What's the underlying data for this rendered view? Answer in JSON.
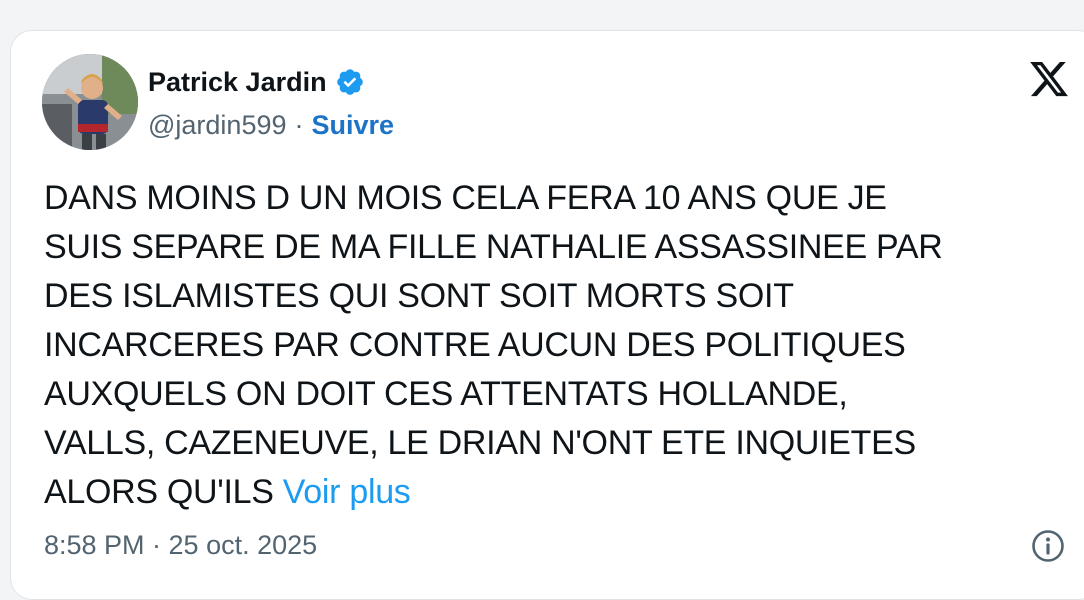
{
  "author": {
    "name": "Patrick Jardin",
    "handle": "@jardin599",
    "separator": "·",
    "follow_label": "Suivre",
    "verified": true,
    "verified_color": "#1d9bf0"
  },
  "tweet": {
    "lines": [
      "DANS MOINS D UN MOIS CELA FERA 10 ANS QUE JE",
      "SUIS SEPARE DE MA FILLE NATHALIE ASSASSINEE PAR",
      "DES ISLAMISTES QUI SONT SOIT MORTS SOIT",
      "INCARCERES PAR CONTRE AUCUN DES POLITIQUES",
      "AUXQUELS ON DOIT CES ATTENTATS HOLLANDE,",
      "VALLS, CAZENEUVE, LE DRIAN N'ONT ETE INQUIETES",
      "ALORS QU'ILS"
    ],
    "more_label": "Voir plus",
    "timestamp": "8:58 PM · 25 oct. 2025"
  },
  "icons": {
    "logo": "x-logo-icon",
    "info": "info-icon",
    "verified": "verified-badge-icon"
  },
  "colors": {
    "link": "#1d9bf0",
    "follow": "#1d74c7",
    "text": "#0f1419",
    "muted": "#536471"
  }
}
